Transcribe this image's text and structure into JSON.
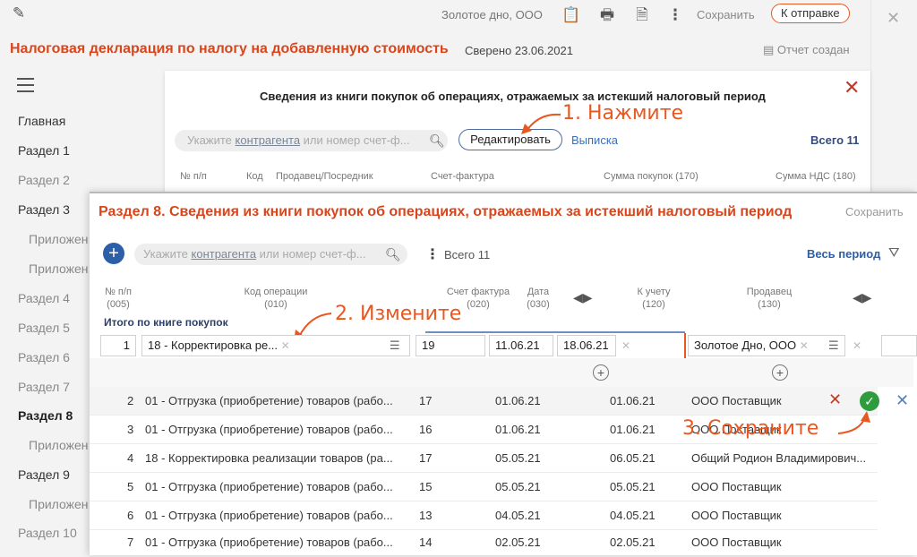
{
  "topbar": {
    "company": "Золотое дно, ООО",
    "save": "Сохранить",
    "send": "К отправке",
    "close_icon": "close-icon"
  },
  "header": {
    "title": "Налоговая декларация по налогу на добавленную стоимость",
    "verified": "Сверено 23.06.2021",
    "report": "Отчет создан"
  },
  "sidebar": {
    "items": [
      {
        "label": "Главная"
      },
      {
        "label": "Раздел 1"
      },
      {
        "label": "Раздел 2"
      },
      {
        "label": "Раздел 3"
      },
      {
        "label": "Приложен"
      },
      {
        "label": "Приложен"
      },
      {
        "label": "Раздел 4"
      },
      {
        "label": "Раздел 5"
      },
      {
        "label": "Раздел 6"
      },
      {
        "label": "Раздел 7"
      },
      {
        "label": "Раздел 8"
      },
      {
        "label": "Приложен"
      },
      {
        "label": "Раздел 9"
      },
      {
        "label": "Приложен"
      },
      {
        "label": "Раздел 10"
      }
    ]
  },
  "card": {
    "title": "Сведения из книги покупок об операциях, отражаемых за истекший налоговый период",
    "search_prefix": "Укажите ",
    "search_link": "контрагента",
    "search_suffix": " или номер счет-ф...",
    "edit": "Редактировать",
    "extract": "Выписка",
    "total": "Всего 11",
    "columns": [
      "№ п/п",
      "Код",
      "Продавец/Посредник",
      "Счет-фактура",
      "Сумма покупок (170)",
      "Сумма НДС (180)"
    ]
  },
  "annotations": {
    "step1": "1. Нажмите",
    "step2": "2. Измените",
    "step3": "3. Сохраните"
  },
  "panel": {
    "title": "Раздел 8. Сведения из книги покупок об операциях, отражаемых за истекший налоговый период",
    "save": "Сохранить",
    "search_prefix": "Укажите ",
    "search_link": "контрагента",
    "search_suffix": " или номер счет-ф...",
    "total": "Всего 11",
    "period": "Весь период",
    "columns": {
      "num": "№ п/п\n(005)",
      "opcode": "Код операции\n(010)",
      "invoice": "Счет фактура\n(020)",
      "date": "Дата\n(030)",
      "accounting": "К учету\n(120)",
      "seller": "Продавец\n(130)"
    },
    "itogo": "Итого по книге покупок",
    "edit_row": {
      "num": "1",
      "opcode": "18 - Корректировка ре...",
      "invoice": "19",
      "date": "11.06.21",
      "accounting": "18.06.21",
      "seller": "Золотое Дно, ООО"
    },
    "rows": [
      {
        "num": "2",
        "opcode": "01 - Отгрузка (приобретение) товаров (рабо...",
        "invoice": "17",
        "date": "01.06.21",
        "accounting": "01.06.21",
        "seller": "ООО Поставщик"
      },
      {
        "num": "3",
        "opcode": "01 - Отгрузка (приобретение) товаров (рабо...",
        "invoice": "16",
        "date": "01.06.21",
        "accounting": "01.06.21",
        "seller": "ООО Поставщик"
      },
      {
        "num": "4",
        "opcode": "18 - Корректировка реализации товаров (ра...",
        "invoice": "17",
        "date": "05.05.21",
        "accounting": "06.05.21",
        "seller": "Общий Родион Владимирович..."
      },
      {
        "num": "5",
        "opcode": "01 - Отгрузка (приобретение) товаров (рабо...",
        "invoice": "15",
        "date": "05.05.21",
        "accounting": "05.05.21",
        "seller": "ООО Поставщик"
      },
      {
        "num": "6",
        "opcode": "01 - Отгрузка (приобретение) товаров (рабо...",
        "invoice": "13",
        "date": "04.05.21",
        "accounting": "04.05.21",
        "seller": "ООО Поставщик"
      },
      {
        "num": "7",
        "opcode": "01 - Отгрузка (приобретение) товаров (рабо...",
        "invoice": "14",
        "date": "02.05.21",
        "accounting": "02.05.21",
        "seller": "ООО Поставщик"
      }
    ]
  }
}
